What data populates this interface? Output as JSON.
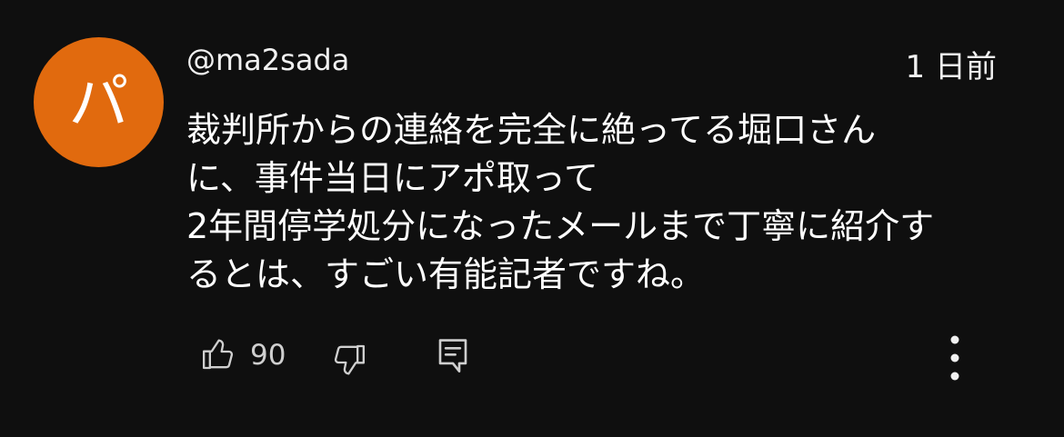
{
  "comment": {
    "avatar_letter": "パ",
    "avatar_color": "#e16a0e",
    "username": "@ma2sada",
    "timestamp": "1 日前",
    "text_lines": [
      "裁判所からの連絡を完全に絶ってる堀口さん",
      "に、事件当日にアポ取って",
      "2年間停学処分になったメールまで丁寧に紹介す",
      "るとは、すごい有能記者ですね。"
    ],
    "like_count": "90"
  },
  "icons": {
    "like": "thumbs-up-icon",
    "dislike": "thumbs-down-icon",
    "reply": "reply-comment-icon",
    "more": "more-vertical-icon"
  },
  "colors": {
    "background": "#0f0f0f",
    "text": "#f1f1f1",
    "icon": "#cfcfcf"
  }
}
